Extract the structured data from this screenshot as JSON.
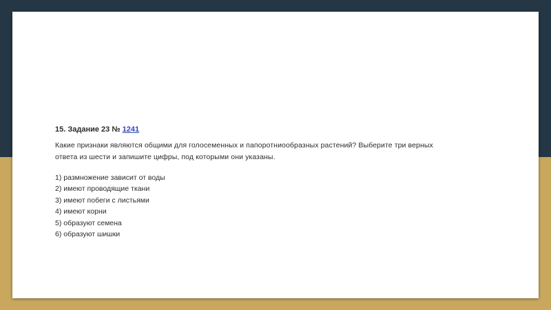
{
  "colors": {
    "background_top": "#253745",
    "background_bottom": "#c9a85e",
    "slide": "#ffffff",
    "link": "#2f46b5"
  },
  "task": {
    "title_prefix": "15. Задание 23 № ",
    "task_number": "1241",
    "question_line1": "Какие признаки являются общими для голосеменных и папоротниообразных растений? Выберите три верных",
    "question_line2": "ответа из шести и запишите цифры, под которыми они указаны.",
    "options": [
      "1) размножение зависит от воды",
      "2) имеют проводящие ткани",
      "3) имеют побеги с листьями",
      "4) имеют корни",
      "5) образуют семена",
      "6) образуют шишки"
    ]
  }
}
